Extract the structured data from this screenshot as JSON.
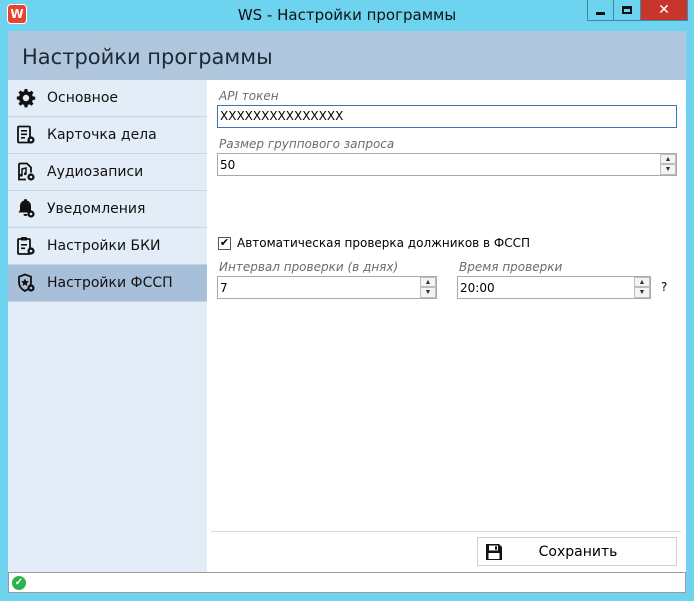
{
  "window": {
    "title": "WS - Настройки программы",
    "app_icon_letter": "W",
    "minimize_icon": "minimize-icon",
    "maximize_icon": "maximize-icon",
    "close_glyph": "✕"
  },
  "header": {
    "title": "Настройки программы"
  },
  "sidebar": {
    "items": [
      {
        "label": "Основное",
        "icon": "gear-icon",
        "active": false
      },
      {
        "label": "Карточка дела",
        "icon": "case-card-icon",
        "active": false
      },
      {
        "label": "Аудиозаписи",
        "icon": "audio-file-icon",
        "active": false
      },
      {
        "label": "Уведомления",
        "icon": "bell-icon",
        "active": false
      },
      {
        "label": "Настройки БКИ",
        "icon": "clipboard-gear-icon",
        "active": false
      },
      {
        "label": "Настройки ФССП",
        "icon": "badge-gear-icon",
        "active": true
      }
    ]
  },
  "form": {
    "api_token": {
      "label": "API токен",
      "value": "XXXXXXXXXXXXXXX"
    },
    "batch_size": {
      "label": "Размер группового запроса",
      "value": "50"
    },
    "auto_check": {
      "label": "Автоматическая проверка должников в ФССП",
      "checked": true
    },
    "check_interval": {
      "label": "Интервал проверки (в днях)",
      "value": "7"
    },
    "check_time": {
      "label": "Время проверки",
      "value": "20:00"
    },
    "help_mark": "?"
  },
  "actions": {
    "save_label": "Сохранить"
  },
  "status": {
    "icon": "check-circle-icon"
  },
  "colors": {
    "titlebar": "#6dd3ef",
    "header": "#b0c6dd",
    "sidebar": "#e3edf7",
    "sidebar_active": "#a8bfd9",
    "close_button": "#c7362a",
    "status_ok": "#2db24a"
  }
}
